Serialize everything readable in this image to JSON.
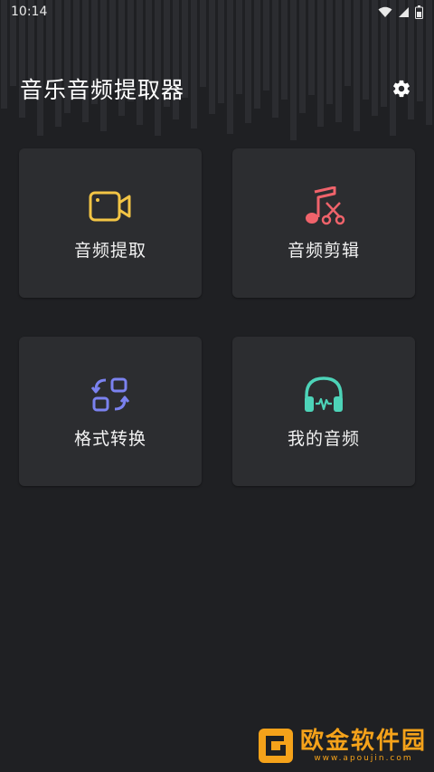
{
  "status_bar": {
    "time": "10:14",
    "icons": [
      "wifi-icon",
      "signal-icon",
      "battery-icon"
    ]
  },
  "header": {
    "title": "音乐音频提取器",
    "settings_icon": "gear-icon"
  },
  "cards": [
    {
      "label": "音频提取",
      "icon": "video-camera-icon",
      "color": "#f3c545"
    },
    {
      "label": "音频剪辑",
      "icon": "music-scissors-icon",
      "color": "#f0636b"
    },
    {
      "label": "格式转换",
      "icon": "convert-icon",
      "color": "#7b82f0"
    },
    {
      "label": "我的音频",
      "icon": "headphones-icon",
      "color": "#4dd3b8"
    }
  ],
  "watermark": {
    "text": "欧金软件园",
    "url": "www.apoujin.com",
    "color": "#f5a21a"
  },
  "colors": {
    "background": "#1f2023",
    "card": "#2c2d30"
  }
}
